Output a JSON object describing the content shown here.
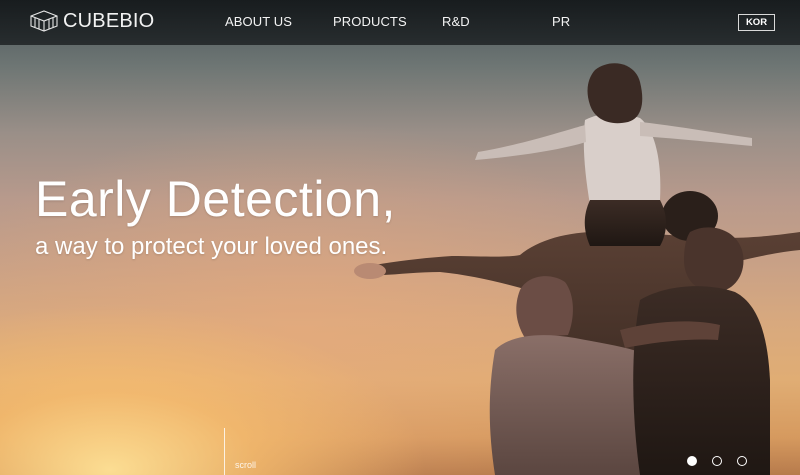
{
  "header": {
    "logo_text": "CUBEBIO",
    "logo_icon": "cube-logo-icon",
    "nav": [
      {
        "label": "ABOUT US"
      },
      {
        "label": "PRODUCTS"
      },
      {
        "label": "R&D"
      },
      {
        "label": "PR"
      }
    ],
    "language_button": "KOR"
  },
  "hero": {
    "headline": "Early Detection,",
    "subline": "a way to protect your loved ones.",
    "scroll_label": "scroll",
    "slides": {
      "total": 3,
      "active": 1
    }
  },
  "colors": {
    "header_bg": "#1c2022",
    "text": "#ffffff"
  }
}
